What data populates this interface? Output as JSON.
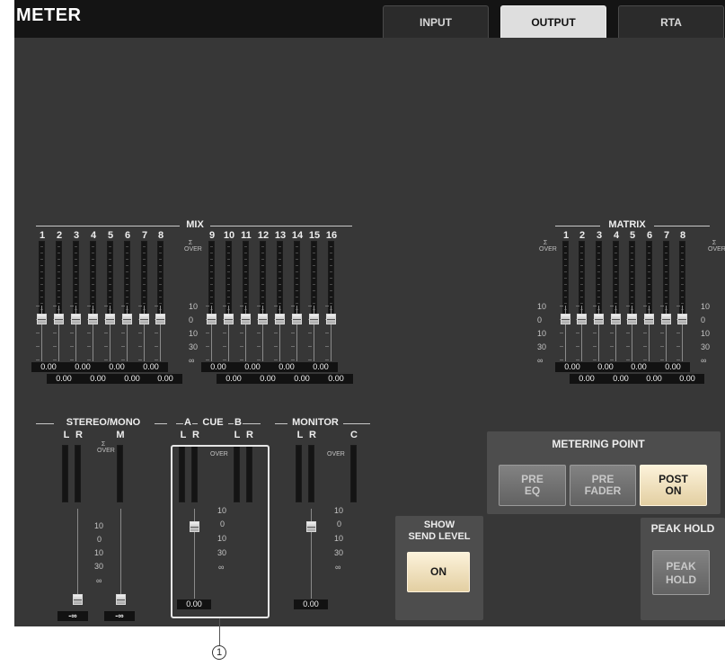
{
  "window": {
    "title": "METER"
  },
  "tabs": [
    {
      "label": "INPUT",
      "active": false
    },
    {
      "label": "OUTPUT",
      "active": true
    },
    {
      "label": "RTA",
      "active": false
    }
  ],
  "mix": {
    "title": "MIX",
    "channels": [
      "1",
      "2",
      "3",
      "4",
      "5",
      "6",
      "7",
      "8",
      "9",
      "10",
      "11",
      "12",
      "13",
      "14",
      "15",
      "16"
    ],
    "over_label": "Σ OVER",
    "scale": [
      "10",
      "0",
      "10",
      "30",
      "∞"
    ],
    "send_values": [
      "0.00",
      "0.00",
      "0.00",
      "0.00",
      "0.00",
      "0.00",
      "0.00",
      "0.00",
      "0.00",
      "0.00",
      "0.00",
      "0.00",
      "0.00",
      "0.00",
      "0.00",
      "0.00"
    ]
  },
  "matrix": {
    "title": "MATRIX",
    "channels": [
      "1",
      "2",
      "3",
      "4",
      "5",
      "6",
      "7",
      "8"
    ],
    "over_label": "Σ OVER",
    "scale": [
      "10",
      "0",
      "10",
      "30",
      "∞"
    ],
    "send_values": [
      "0.00",
      "0.00",
      "0.00",
      "0.00",
      "0.00",
      "0.00",
      "0.00",
      "0.00"
    ]
  },
  "stereo_mono": {
    "title": "STEREO/MONO",
    "channels": [
      "L",
      "R",
      "M"
    ],
    "over_label": "Σ OVER",
    "scale": [
      "10",
      "0",
      "10",
      "30",
      "∞"
    ],
    "values": [
      "-∞",
      "-∞"
    ]
  },
  "cue": {
    "title": "CUE",
    "group_a": "A",
    "group_b": "B",
    "channels": [
      "L",
      "R",
      "L",
      "R"
    ],
    "over_label": "OVER",
    "scale": [
      "10",
      "0",
      "10",
      "30",
      "∞"
    ],
    "value": "0.00"
  },
  "monitor": {
    "title": "MONITOR",
    "channels": [
      "L",
      "R",
      "C"
    ],
    "over_label": "OVER",
    "scale": [
      "10",
      "0",
      "10",
      "30",
      "∞"
    ],
    "value": "0.00"
  },
  "metering_point": {
    "title": "METERING POINT",
    "buttons": [
      {
        "label_line1": "PRE",
        "label_line2": "EQ",
        "active": false
      },
      {
        "label_line1": "PRE",
        "label_line2": "FADER",
        "active": false
      },
      {
        "label_line1": "POST",
        "label_line2": "ON",
        "active": true
      }
    ]
  },
  "show_send_level": {
    "title_line1": "SHOW",
    "title_line2": "SEND LEVEL",
    "button": "ON"
  },
  "peak_hold": {
    "title": "PEAK HOLD",
    "button_line1": "PEAK",
    "button_line2": "HOLD"
  },
  "callout": {
    "number": "1"
  }
}
